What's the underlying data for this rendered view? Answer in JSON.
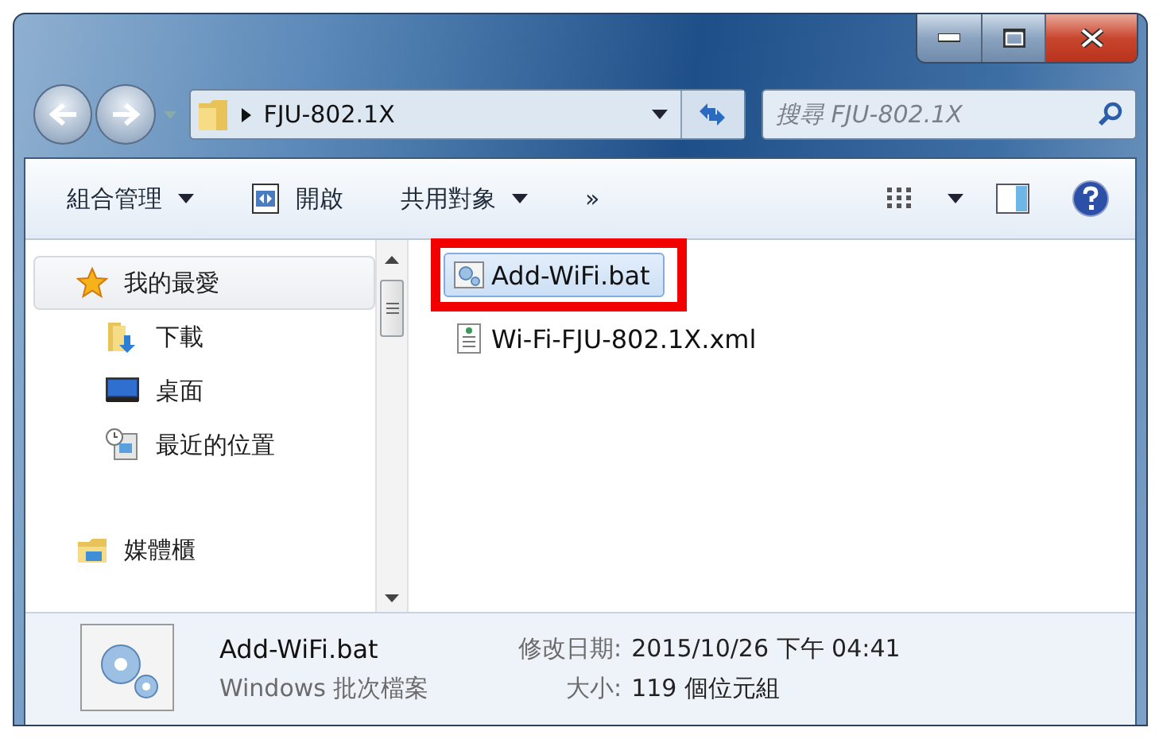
{
  "address": {
    "path": "FJU-802.1X"
  },
  "search": {
    "placeholder": "搜尋 FJU-802.1X"
  },
  "toolbar": [
    {
      "label": "組合管理",
      "kind": "menu"
    },
    {
      "label": "開啟",
      "kind": "open"
    },
    {
      "label": "共用對象",
      "kind": "menu"
    },
    {
      "label": "»",
      "kind": "overflow"
    }
  ],
  "nav_pane": [
    {
      "label": "我的最愛",
      "selected": true,
      "children": [
        {
          "label": "下載",
          "selected": false
        },
        {
          "label": "桌面",
          "selected": false
        },
        {
          "label": "最近的位置",
          "selected": false
        }
      ]
    },
    {
      "label": "媒體櫃",
      "selected": false
    }
  ],
  "files": [
    {
      "name": "Add-WiFi.bat",
      "selected": true,
      "marked": true
    },
    {
      "name": "Wi-Fi-FJU-802.1X.xml",
      "selected": false,
      "marked": false
    }
  ],
  "details": {
    "name": "Add-WiFi.bat",
    "type": "Windows 批次檔案",
    "fields": [
      {
        "label": "修改日期:",
        "value": "2015/10/26 下午 04:41"
      },
      {
        "label": "大小:",
        "value": "119 個位元組"
      }
    ]
  }
}
